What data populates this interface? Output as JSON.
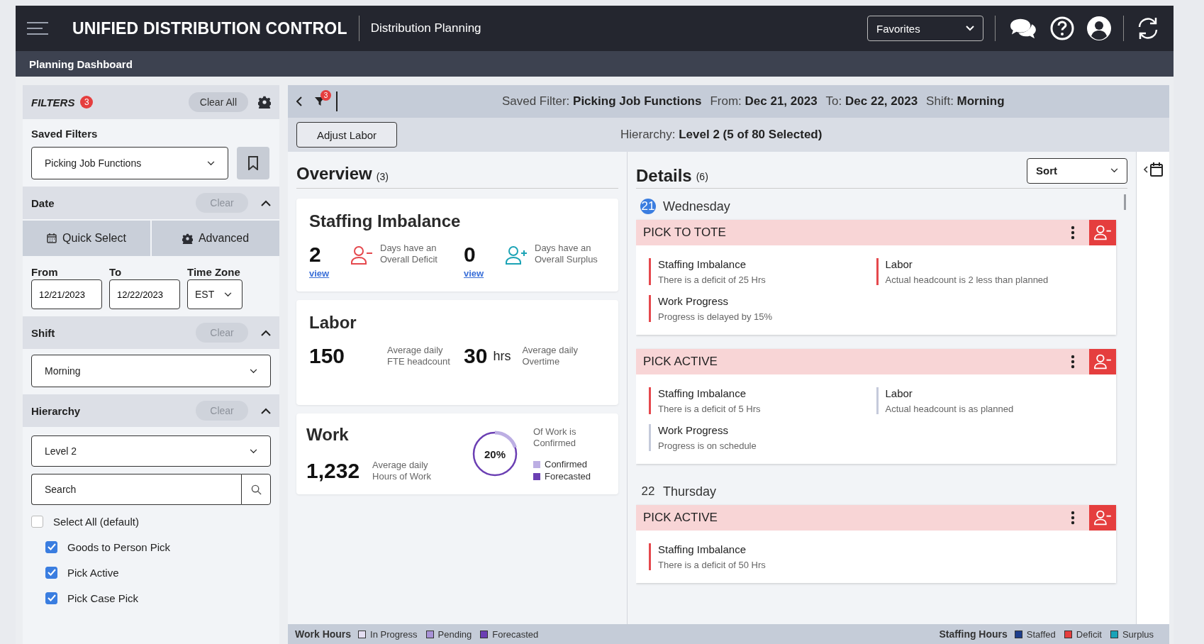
{
  "header": {
    "title": "UNIFIED DISTRIBUTION CONTROL",
    "subtitle": "Distribution Planning",
    "favorites": "Favorites"
  },
  "breadcrumb": "Planning Dashboard",
  "filters": {
    "title": "FILTERS",
    "count": "3",
    "clear_all": "Clear All",
    "saved": {
      "label": "Saved Filters",
      "value": "Picking Job Functions"
    },
    "date": {
      "title": "Date",
      "clear": "Clear",
      "clear_disabled": true,
      "expanded": true,
      "quick_select": "Quick Select",
      "advanced": "Advanced",
      "from_label": "From",
      "from": "12/21/2023",
      "to_label": "To",
      "to": "12/22/2023",
      "tz_label": "Time Zone",
      "tz": "EST"
    },
    "shift": {
      "title": "Shift",
      "clear": "Clear",
      "clear_disabled": true,
      "expanded": true,
      "value": "Morning"
    },
    "hierarchy": {
      "title": "Hierarchy",
      "clear": "Clear",
      "clear_disabled": true,
      "expanded": true,
      "value": "Level 2",
      "search_placeholder": "Search",
      "select_all": {
        "label": "Select All (default)",
        "checked": false
      },
      "items": [
        {
          "label": "Goods to Person Pick",
          "checked": true
        },
        {
          "label": "Pick Active",
          "checked": true
        },
        {
          "label": "Pick Case Pick",
          "checked": true
        }
      ]
    }
  },
  "toolbar": {
    "filter_count": "3",
    "summary": [
      "Saved Filter: **Picking Job Functions**",
      "From: **Dec 21, 2023**",
      "To: **Dec 22, 2023**",
      "Shift: **Morning**"
    ],
    "adjust_labor": "Adjust Labor",
    "hierarchy": "Hierarchy: **Level 2 (5 of 80 Selected)**"
  },
  "overview": {
    "title": "Overview",
    "count": "(3)",
    "staffing": {
      "title": "Staffing Imbalance",
      "stats": [
        {
          "kind": "deficit",
          "value": "2",
          "link": "view",
          "caption": "Days have an Overall Deficit"
        },
        {
          "kind": "surplus",
          "value": "0",
          "link": "view",
          "caption": "Days have an Overall Surplus"
        }
      ]
    },
    "labor": {
      "title": "Labor",
      "stats": [
        {
          "value": "150",
          "caption": "Average daily FTE headcount"
        },
        {
          "value": "30",
          "unit": "hrs",
          "caption": "Average daily Overtime"
        }
      ]
    },
    "work": {
      "title": "Work",
      "value": "1,232",
      "caption": "Average daily Hours of Work",
      "percent": "20%",
      "level": 0.2,
      "ring_caption": "Of Work is Confirmed",
      "legend": [
        {
          "label": "Confirmed",
          "color": "#bcaee3"
        },
        {
          "label": "Forecasted",
          "color": "#6b3fb3"
        }
      ]
    }
  },
  "details": {
    "title": "Details",
    "count": "(6)",
    "sort": "Sort",
    "days": [
      {
        "day": "21",
        "name": "Wednesday",
        "selected": true,
        "cards": [
          {
            "title": "PICK TO TOTE",
            "metrics": [
              {
                "title": "Staffing Imbalance",
                "text": "There is a deficit of 25 Hrs",
                "alert": true
              },
              {
                "title": "Labor",
                "text": "Actual headcount is 2 less than planned",
                "alert": true
              },
              {
                "title": "Work Progress",
                "text": "Progress is delayed by 15%",
                "alert": true
              }
            ]
          },
          {
            "title": "PICK ACTIVE",
            "metrics": [
              {
                "title": "Staffing Imbalance",
                "text": "There is a deficit of 5 Hrs",
                "alert": true
              },
              {
                "title": "Labor",
                "text": "Actual headcount is as planned",
                "alert": false
              },
              {
                "title": "Work Progress",
                "text": "Progress is on schedule",
                "alert": false
              }
            ]
          }
        ]
      },
      {
        "day": "22",
        "name": "Thursday",
        "selected": false,
        "cards": [
          {
            "title": "PICK ACTIVE",
            "metrics": [
              {
                "title": "Staffing Imbalance",
                "text": "There is a deficit of 50 Hrs",
                "alert": true
              }
            ]
          }
        ]
      }
    ]
  },
  "footer": {
    "work_hours": {
      "title": "Work Hours",
      "items": [
        {
          "label": "In Progress",
          "color": "#e4def2"
        },
        {
          "label": "Pending",
          "color": "#a892d6"
        },
        {
          "label": "Forecasted",
          "color": "#6b3fb3"
        }
      ]
    },
    "staffing_hours": {
      "title": "Staffing Hours",
      "items": [
        {
          "label": "Staffed",
          "color": "#1e3e8c"
        },
        {
          "label": "Deficit",
          "color": "#e53e3e"
        },
        {
          "label": "Surplus",
          "color": "#1aa3b8"
        }
      ]
    }
  }
}
